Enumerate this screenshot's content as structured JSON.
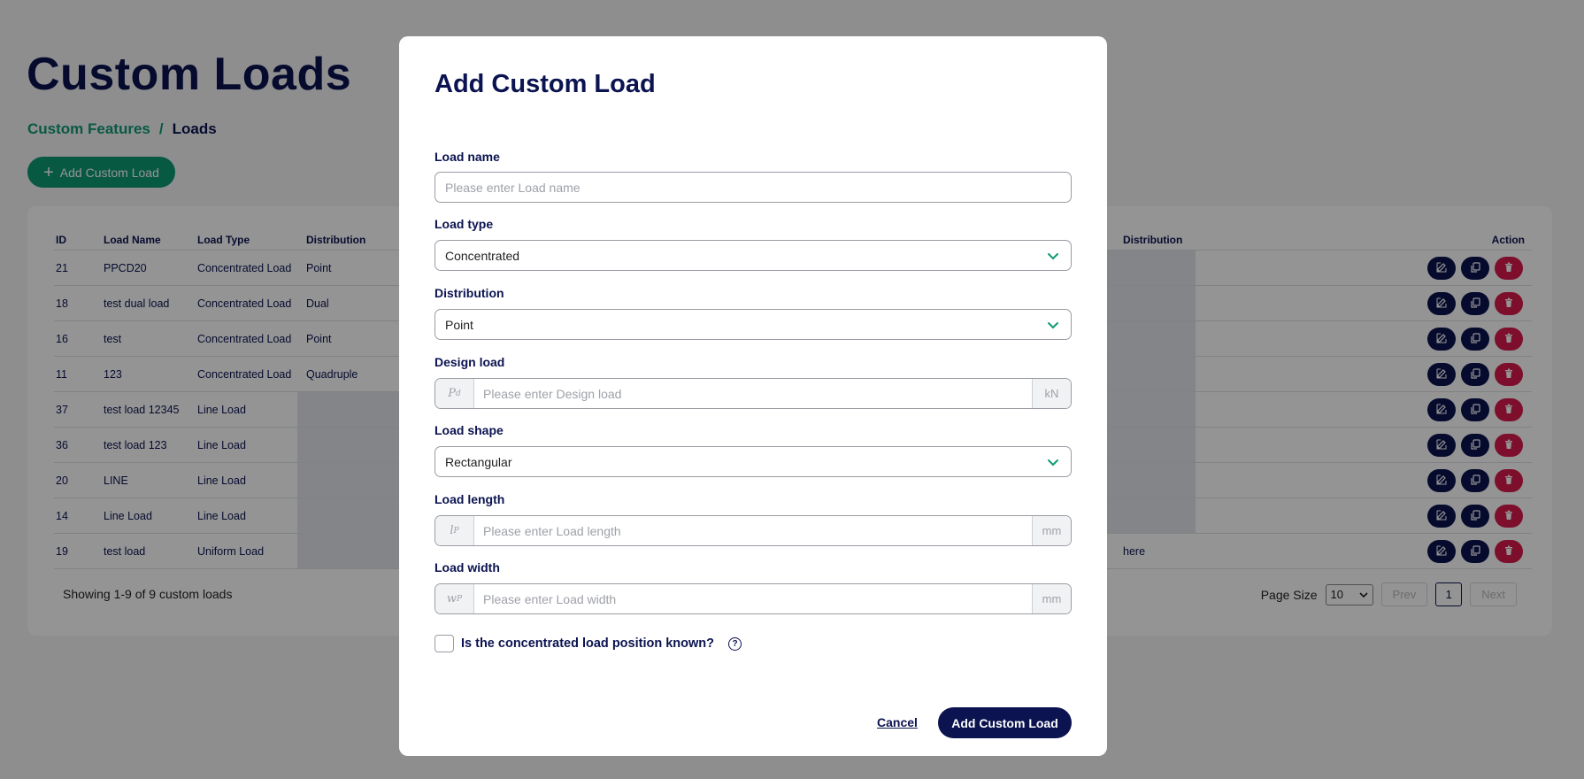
{
  "page": {
    "title": "Custom Loads",
    "breadcrumb": {
      "parent": "Custom Features",
      "separator": "/",
      "current": "Loads"
    },
    "add_button_label": "Add Custom Load",
    "table": {
      "headers": {
        "id": "ID",
        "name": "Load Name",
        "type": "Load Type",
        "distribution": "Distribution",
        "distribution2": "Distribution",
        "action": "Action"
      },
      "rows": [
        {
          "id": "21",
          "name": "PPCD20",
          "type": "Concentrated Load",
          "distribution": "Point",
          "right": ""
        },
        {
          "id": "18",
          "name": "test dual load",
          "type": "Concentrated Load",
          "distribution": "Dual",
          "right": ""
        },
        {
          "id": "16",
          "name": "test",
          "type": "Concentrated Load",
          "distribution": "Point",
          "right": ""
        },
        {
          "id": "11",
          "name": "123",
          "type": "Concentrated Load",
          "distribution": "Quadruple",
          "right": ""
        },
        {
          "id": "37",
          "name": "test load 12345",
          "type": "Line Load",
          "distribution": "",
          "right": ""
        },
        {
          "id": "36",
          "name": "test load 123",
          "type": "Line Load",
          "distribution": "",
          "right": ""
        },
        {
          "id": "20",
          "name": "LINE",
          "type": "Line Load",
          "distribution": "",
          "right": ""
        },
        {
          "id": "14",
          "name": "Line Load",
          "type": "Line Load",
          "distribution": "",
          "right": ""
        },
        {
          "id": "19",
          "name": "test load",
          "type": "Uniform Load",
          "distribution": "",
          "right": "here"
        }
      ]
    },
    "footer": {
      "showing": "Showing 1-9 of 9 custom loads",
      "page_size_label": "Page Size",
      "page_size_value": "10",
      "prev": "Prev",
      "current_page": "1",
      "next": "Next"
    }
  },
  "modal": {
    "title": "Add Custom Load",
    "fields": {
      "load_name": {
        "label": "Load name",
        "placeholder": "Please enter Load name"
      },
      "load_type": {
        "label": "Load type",
        "value": "Concentrated"
      },
      "distribution": {
        "label": "Distribution",
        "value": "Point"
      },
      "design_load": {
        "label": "Design load",
        "prefix": "P",
        "prefix_sub": "d",
        "placeholder": "Please enter Design load",
        "unit": "kN"
      },
      "load_shape": {
        "label": "Load shape",
        "value": "Rectangular"
      },
      "load_length": {
        "label": "Load length",
        "prefix": "l",
        "prefix_sub": "P",
        "placeholder": "Please enter Load length",
        "unit": "mm"
      },
      "load_width": {
        "label": "Load width",
        "prefix": "w",
        "prefix_sub": "P",
        "placeholder": "Please enter Load width",
        "unit": "mm"
      }
    },
    "checkbox_label": "Is the concentrated load position known?",
    "help_icon": "?",
    "cancel_label": "Cancel",
    "submit_label": "Add Custom Load"
  },
  "colors": {
    "navy": "#0b1350",
    "green": "#0e9a73",
    "red": "#d81b4d"
  }
}
